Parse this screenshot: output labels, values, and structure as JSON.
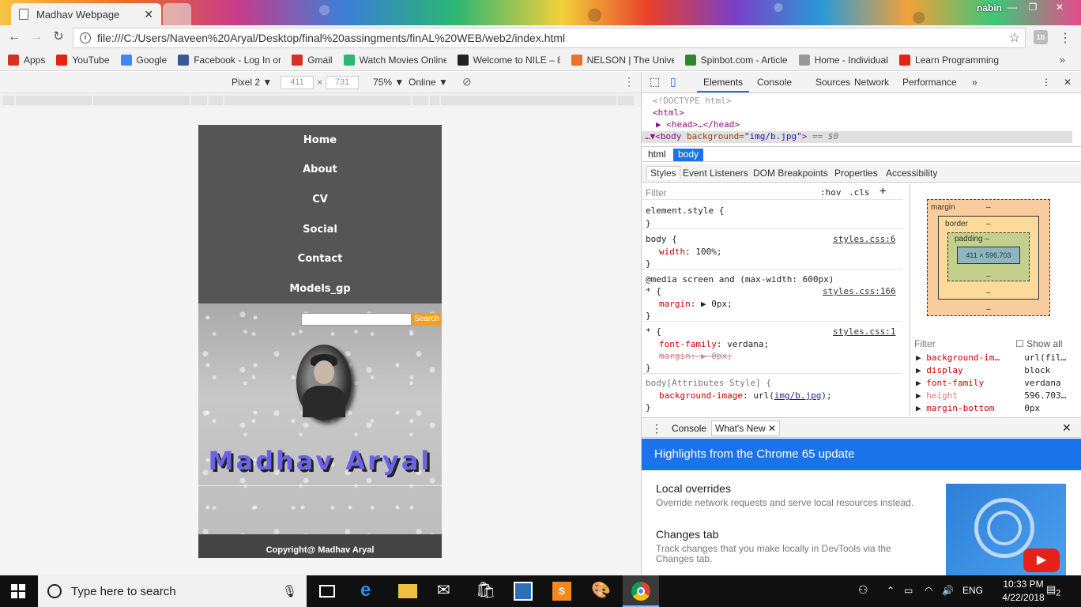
{
  "browser": {
    "tab_title": "Madhav Webpage",
    "user": "nabin",
    "url": "file:///C:/Users/Naveen%20Aryal/Desktop/final%20assingments/finAL%20WEB/web2/index.html",
    "bookmarks": [
      {
        "label": "Apps",
        "icon": "apps-grid-icon",
        "color": "#d93025"
      },
      {
        "label": "YouTube",
        "icon": "youtube-icon",
        "color": "#e62117"
      },
      {
        "label": "Google",
        "icon": "google-icon",
        "color": "#4285f4"
      },
      {
        "label": "Facebook - Log In or",
        "icon": "facebook-icon",
        "color": "#3b5998"
      },
      {
        "label": "Gmail",
        "icon": "gmail-icon",
        "color": "#d93025"
      },
      {
        "label": "Watch Movies Online",
        "icon": "play-icon",
        "color": "#2bb673"
      },
      {
        "label": "Welcome to NILE – 8",
        "icon": "bb-icon",
        "color": "#222222"
      },
      {
        "label": "NELSON | The Unive",
        "icon": "nelson-icon",
        "color": "#e8712b"
      },
      {
        "label": "Spinbot.com - Article",
        "icon": "spinbot-icon",
        "color": "#2a8a2a"
      },
      {
        "label": "Home - Individual",
        "icon": "home-individual-icon",
        "color": "#999999"
      },
      {
        "label": "Learn Programming",
        "icon": "youtube-icon",
        "color": "#e62117"
      }
    ]
  },
  "device_toolbar": {
    "device": "Pixel 2",
    "width": "411",
    "height": "731",
    "zoom": "75%",
    "network": "Online"
  },
  "site": {
    "nav": [
      "Home",
      "About",
      "CV",
      "Social",
      "Contact",
      "Models_gp"
    ],
    "search_button": "Search",
    "name": "Madhav Aryal",
    "footer": "Copyright@ Madhav Aryal"
  },
  "devtools": {
    "tabs": [
      "Elements",
      "Console",
      "Sources",
      "Network",
      "Performance"
    ],
    "dom": {
      "doctype": "<!DOCTYPE html>",
      "html_open": "<html>",
      "head": "<head>…</head>",
      "body_tag": "<body",
      "body_attr_name": "background=",
      "body_attr_value": "\"img/b.jpg\"",
      "body_close": ">",
      "selected_marker": "== $0"
    },
    "breadcrumbs": [
      "html",
      "body"
    ],
    "style_tabs": [
      "Styles",
      "Event Listeners",
      "DOM Breakpoints",
      "Properties",
      "Accessibility"
    ],
    "filter_placeholder": "Filter",
    "hov": ":hov",
    "cls": ".cls",
    "styles": {
      "element_style": "element.style {",
      "close": "}",
      "body_sel": "body {",
      "body_src": "styles.css:6",
      "width_prop": "width",
      "width_val": ": 100%;",
      "media": "@media screen and (max-width: 600px)",
      "star_sel": "* {",
      "star_src_166": "styles.css:166",
      "margin_prop": "margin",
      "margin_val": ": ▶ 0px;",
      "star_src_1": "styles.css:1",
      "ff_prop": "font-family",
      "ff_val": ": verdana;",
      "margin_struck": "margin: ▶ 0px;",
      "attr_sel": "body[Attributes Style] {",
      "bgimg_prop": "background-image",
      "bgimg_pre": ": url(",
      "bgimg_url": "img/b.jpg",
      "bgimg_post": ");"
    },
    "box_model": {
      "margin": "margin",
      "border": "border",
      "padding": "padding –",
      "content": "411 × 596.703",
      "dash": "–"
    },
    "computed": {
      "filter": "Filter",
      "show_all": "Show all",
      "rows": [
        {
          "prop": "background-im…",
          "value": "url(fil…",
          "color": "#c80000"
        },
        {
          "prop": "display",
          "value": "block",
          "color": "#c80000"
        },
        {
          "prop": "font-family",
          "value": "verdana",
          "color": "#c80000"
        },
        {
          "prop": "height",
          "value": "596.703…",
          "color": "#d08080"
        },
        {
          "prop": "margin-bottom",
          "value": "0px",
          "color": "#c80000"
        }
      ]
    },
    "drawer": {
      "tabs": [
        "Console",
        "What's New"
      ],
      "banner": "Highlights from the Chrome 65 update",
      "items": [
        {
          "title": "Local overrides",
          "desc": "Override network requests and serve local resources instead."
        },
        {
          "title": "Changes tab",
          "desc": "Track changes that you make locally in DevTools via the Changes tab."
        }
      ]
    }
  },
  "taskbar": {
    "search_placeholder": "Type here to search",
    "lang": "ENG",
    "time": "10:33 PM",
    "date": "4/22/2018",
    "notifications": "2"
  }
}
